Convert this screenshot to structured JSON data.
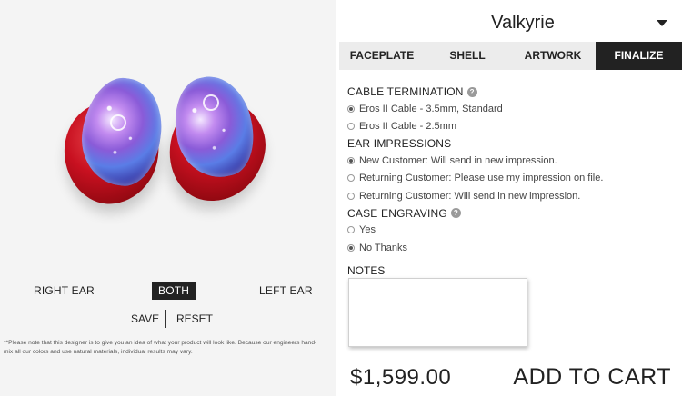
{
  "product": {
    "title": "Valkyrie"
  },
  "tabs": [
    {
      "label": "FACEPLATE"
    },
    {
      "label": "SHELL"
    },
    {
      "label": "ARTWORK"
    },
    {
      "label": "FINALIZE",
      "active": true
    }
  ],
  "ear_select": {
    "right": "RIGHT EAR",
    "both": "BOTH",
    "left": "LEFT EAR",
    "selected": "BOTH"
  },
  "actions": {
    "save": "SAVE",
    "reset": "RESET"
  },
  "disclaimer": "**Please note that this designer is to give you an idea of what your product will look like. Because our engineers hand-mix all our colors and use natural materials, individual results may vary.",
  "sections": {
    "cable": {
      "title": "CABLE TERMINATION",
      "options": [
        {
          "label": "Eros II Cable - 3.5mm, Standard",
          "checked": true
        },
        {
          "label": "Eros II Cable - 2.5mm",
          "checked": false
        }
      ]
    },
    "impressions": {
      "title": "EAR IMPRESSIONS",
      "options": [
        {
          "label": "New Customer: Will send in new impression.",
          "checked": true
        },
        {
          "label": "Returning Customer: Please use my impression on file.",
          "checked": false
        },
        {
          "label": "Returning Customer: Will send in new impression.",
          "checked": false
        }
      ]
    },
    "engraving": {
      "title": "CASE ENGRAVING",
      "options": [
        {
          "label": "Yes",
          "checked": false
        },
        {
          "label": "No Thanks",
          "checked": true
        }
      ]
    },
    "notes": {
      "title": "NOTES",
      "value": ""
    }
  },
  "price": "$1,599.00",
  "cart_label": "ADD TO CART",
  "help_glyph": "?",
  "colors": {
    "accent": "#222222",
    "tab_bg": "#ececec",
    "shell": "#c81020",
    "panel_bg": "#f4f4f4"
  },
  "icons": {
    "caret": "chevron-down-icon",
    "help": "help-icon"
  }
}
